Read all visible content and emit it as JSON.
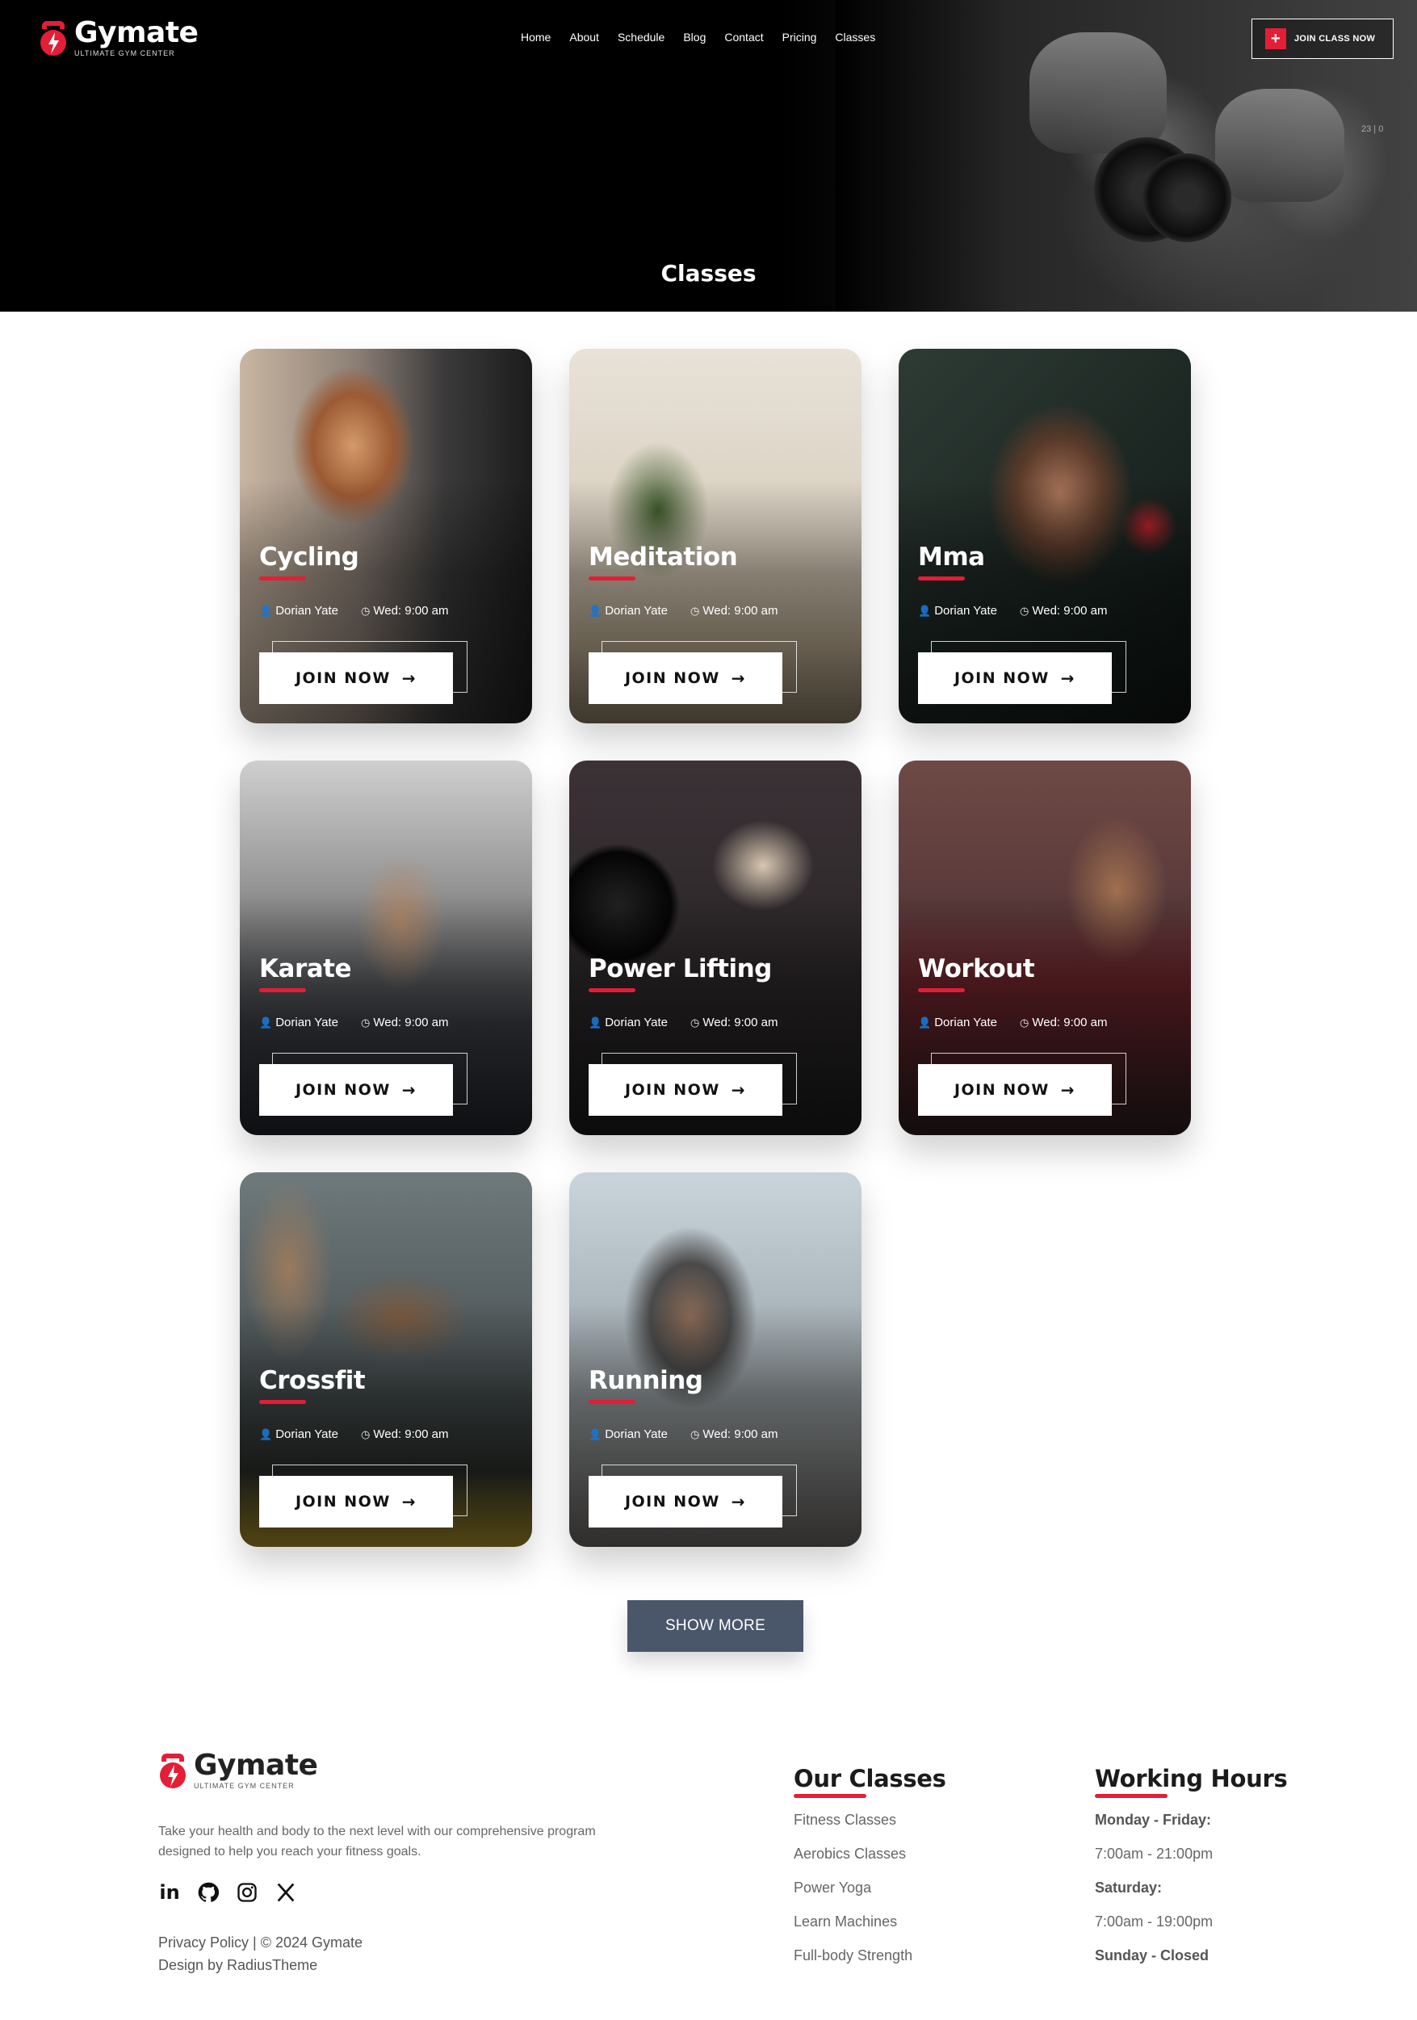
{
  "header": {
    "brand": "Gymate",
    "tagline": "ULTIMATE GYM CENTER",
    "nav": [
      "Home",
      "About",
      "Schedule",
      "Blog",
      "Contact",
      "Pricing",
      "Classes"
    ],
    "cta": "JOIN CLASS NOW",
    "side_text": "23 | 0"
  },
  "hero": {
    "title": "Classes"
  },
  "classes": [
    {
      "title": "Cycling",
      "trainer": "Dorian Yate",
      "time": "Wed: 9:00 am",
      "button": "JOIN NOW"
    },
    {
      "title": "Meditation",
      "trainer": "Dorian Yate",
      "time": "Wed: 9:00 am",
      "button": "JOIN NOW"
    },
    {
      "title": "Mma",
      "trainer": "Dorian Yate",
      "time": "Wed: 9:00 am",
      "button": "JOIN NOW"
    },
    {
      "title": "Karate",
      "trainer": "Dorian Yate",
      "time": "Wed: 9:00 am",
      "button": "JOIN NOW"
    },
    {
      "title": "Power Lifting",
      "trainer": "Dorian Yate",
      "time": "Wed: 9:00 am",
      "button": "JOIN NOW"
    },
    {
      "title": "Workout",
      "trainer": "Dorian Yate",
      "time": "Wed: 9:00 am",
      "button": "JOIN NOW"
    },
    {
      "title": "Crossfit",
      "trainer": "Dorian Yate",
      "time": "Wed: 9:00 am",
      "button": "JOIN NOW"
    },
    {
      "title": "Running",
      "trainer": "Dorian Yate",
      "time": "Wed: 9:00 am",
      "button": "JOIN NOW"
    }
  ],
  "show_more": "SHOW MORE",
  "footer": {
    "brand": "Gymate",
    "tagline": "ULTIMATE GYM CENTER",
    "description": "Take your health and body to the next level with our comprehensive program designed to help you reach your fitness goals.",
    "social": [
      "linkedin-icon",
      "github-icon",
      "instagram-icon",
      "x-icon"
    ],
    "legal_line1": "Privacy Policy | © 2024 Gymate",
    "legal_line2": "Design by RadiusTheme",
    "our_classes": {
      "title": "Our Classes",
      "items": [
        "Fitness Classes",
        "Aerobics Classes",
        "Power Yoga",
        "Learn Machines",
        "Full-body Strength"
      ]
    },
    "working_hours": {
      "title": "Working Hours",
      "items": [
        "Monday - Friday:",
        "7:00am - 21:00pm",
        "Saturday:",
        "7:00am - 19:00pm",
        "Sunday - Closed"
      ]
    }
  },
  "colors": {
    "accent": "#e31e36",
    "button_dark": "#4a566a"
  }
}
